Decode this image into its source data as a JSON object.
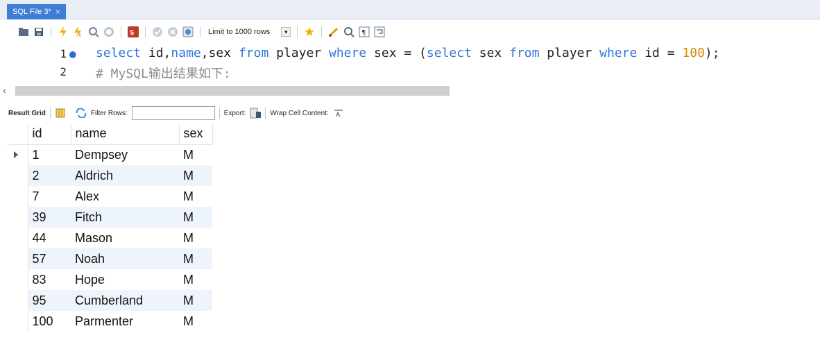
{
  "tab": {
    "title": "SQL File 3*",
    "close_glyph": "×"
  },
  "toolbar": {
    "limit_label": "Limit to 1000 rows",
    "icons": [
      "open-folder-icon",
      "save-icon",
      "execute-icon",
      "execute-current-icon",
      "explain-icon",
      "stop-icon",
      "toggle-error-icon",
      "commit-icon",
      "rollback-icon",
      "autocommit-icon",
      "limit-dropdown-icon",
      "beautify-icon",
      "find-icon",
      "invisible-chars-icon",
      "wrap-icon"
    ]
  },
  "editor": {
    "lines": [
      {
        "number": "1",
        "has_marker": true
      },
      {
        "number": "2",
        "has_marker": false
      }
    ],
    "line1_tokens": {
      "t1": "select",
      "t2": " id,",
      "t3": "name",
      "t4": ",sex ",
      "t5": "from",
      "t6": " player ",
      "t7": "where",
      "t8": " sex = (",
      "t9": "select",
      "t10": " sex ",
      "t11": "from",
      "t12": " player ",
      "t13": "where",
      "t14": " id = ",
      "t15": "100",
      "t16": ");"
    },
    "line2_comment": "# MySQL输出结果如下:"
  },
  "result_toolbar": {
    "result_grid_label": "Result Grid",
    "filter_rows_label": "Filter Rows:",
    "filter_value": "",
    "export_label": "Export:",
    "wrap_label": "Wrap Cell Content:"
  },
  "grid": {
    "columns": [
      "id",
      "name",
      "sex"
    ],
    "rows": [
      [
        "1",
        "Dempsey",
        "M"
      ],
      [
        "2",
        "Aldrich",
        "M"
      ],
      [
        "7",
        "Alex",
        "M"
      ],
      [
        "39",
        "Fitch",
        "M"
      ],
      [
        "44",
        "Mason",
        "M"
      ],
      [
        "57",
        "Noah",
        "M"
      ],
      [
        "83",
        "Hope",
        "M"
      ],
      [
        "95",
        "Cumberland",
        "M"
      ],
      [
        "100",
        "Parmenter",
        "M"
      ]
    ]
  },
  "colors": {
    "tab_active": "#3d7fd6",
    "keyword": "#2e75d6",
    "number": "#d38b00",
    "comment": "#8c8c8c",
    "alt_row": "#eef4fc"
  }
}
